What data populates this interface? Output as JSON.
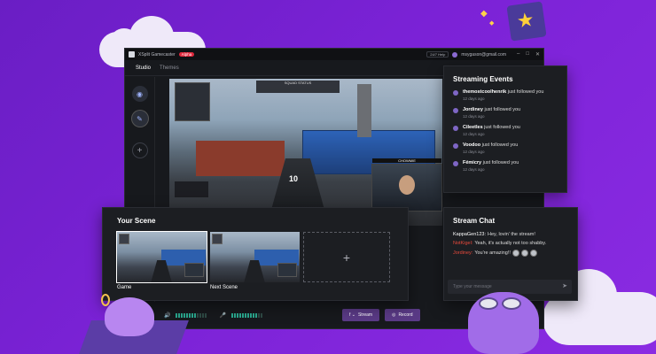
{
  "titlebar": {
    "app_name": "XSplit Gamecaster",
    "badge": "Alpha",
    "help": "24/7 Help",
    "email": "msygason@gmail.com"
  },
  "tabs": [
    "Studio",
    "Themes"
  ],
  "preview": {
    "hud_top": "SQUAD STATUS",
    "ammo": "10",
    "webcam_label": "CHOWMIE"
  },
  "events": {
    "title": "Streaming Events",
    "items": [
      {
        "user": "themostcoolhenrik",
        "action": " just followed you",
        "ago": "12 days ago"
      },
      {
        "user": "Jordiney",
        "action": " just followed you",
        "ago": "12 days ago"
      },
      {
        "user": "Cileetles",
        "action": " just followed you",
        "ago": "12 days ago"
      },
      {
        "user": "Voodoo",
        "action": " just followed you",
        "ago": "12 days ago"
      },
      {
        "user": "Fémicry",
        "action": " just followed you",
        "ago": "12 days ago"
      }
    ]
  },
  "scene": {
    "title": "Your Scene",
    "labels": [
      "Game",
      "Next Scene"
    ],
    "add": "+"
  },
  "chat": {
    "title": "Stream Chat",
    "lines": [
      {
        "user": "KappaGen123:",
        "text": " Hey, lovin' the stream!"
      },
      {
        "user": "NotKigel:",
        "text": " Yeah, it's actually not too shabby."
      },
      {
        "user": "Jordiney:",
        "text": " You're amazing!!"
      }
    ],
    "placeholder": "Type your message"
  },
  "controls": {
    "stream_label": "Stream",
    "record_label": "Record"
  },
  "colors": {
    "accent": "#5a3a86",
    "background": "#7b22d6",
    "alert": "#e0283c"
  }
}
